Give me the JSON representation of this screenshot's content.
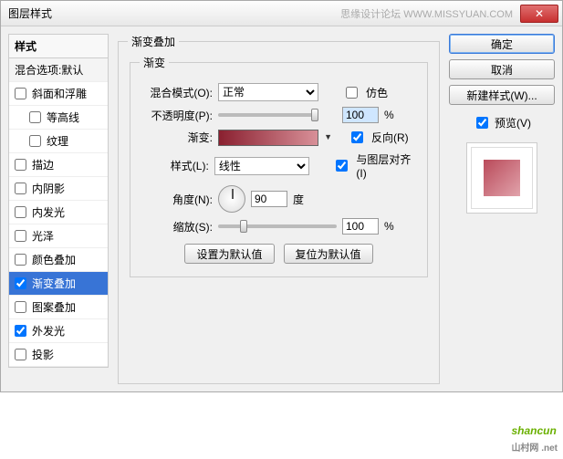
{
  "titlebar": {
    "title": "图层样式",
    "watermark": "思缘设计论坛 WWW.MISSYUAN.COM"
  },
  "left": {
    "header": "样式",
    "blending": "混合选项:默认",
    "items": [
      {
        "label": "斜面和浮雕",
        "checked": false,
        "active": false,
        "indent": false
      },
      {
        "label": "等高线",
        "checked": false,
        "active": false,
        "indent": true
      },
      {
        "label": "纹理",
        "checked": false,
        "active": false,
        "indent": true
      },
      {
        "label": "描边",
        "checked": false,
        "active": false,
        "indent": false
      },
      {
        "label": "内阴影",
        "checked": false,
        "active": false,
        "indent": false
      },
      {
        "label": "内发光",
        "checked": false,
        "active": false,
        "indent": false
      },
      {
        "label": "光泽",
        "checked": false,
        "active": false,
        "indent": false
      },
      {
        "label": "颜色叠加",
        "checked": false,
        "active": false,
        "indent": false
      },
      {
        "label": "渐变叠加",
        "checked": true,
        "active": true,
        "indent": false
      },
      {
        "label": "图案叠加",
        "checked": false,
        "active": false,
        "indent": false
      },
      {
        "label": "外发光",
        "checked": true,
        "active": false,
        "indent": false
      },
      {
        "label": "投影",
        "checked": false,
        "active": false,
        "indent": false
      }
    ]
  },
  "center": {
    "group_title": "渐变叠加",
    "inner_title": "渐变",
    "blend_mode_label": "混合模式(O):",
    "blend_mode_value": "正常",
    "dither_label": "仿色",
    "dither_checked": false,
    "opacity_label": "不透明度(P):",
    "opacity_value": "100",
    "gradient_label": "渐变:",
    "reverse_label": "反向(R)",
    "reverse_checked": true,
    "style_label": "样式(L):",
    "style_value": "线性",
    "align_label": "与图层对齐(I)",
    "align_checked": true,
    "angle_label": "角度(N):",
    "angle_value": "90",
    "angle_unit": "度",
    "scale_label": "缩放(S):",
    "scale_value": "100",
    "percent": "%",
    "reset_default": "设置为默认值",
    "revert_default": "复位为默认值"
  },
  "right": {
    "ok": "确定",
    "cancel": "取消",
    "new_style": "新建样式(W)...",
    "preview_label": "预览(V)",
    "preview_checked": true
  },
  "logo": {
    "text": "shancun",
    "sub": "山村网 .net"
  }
}
